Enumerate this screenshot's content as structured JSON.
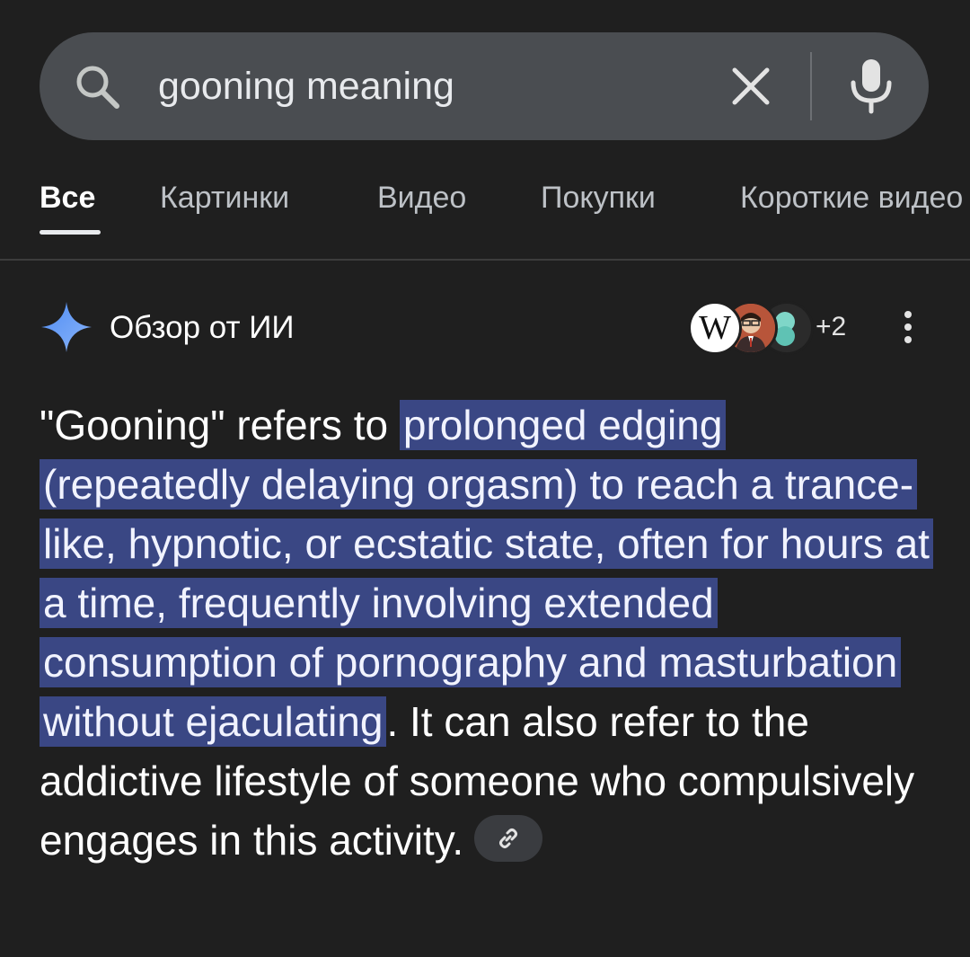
{
  "search": {
    "query": "gooning meaning",
    "icons": {
      "search": "search-icon",
      "clear": "close-icon",
      "voice": "microphone-icon"
    }
  },
  "tabs": [
    {
      "label": "Все",
      "active": true
    },
    {
      "label": "Картинки",
      "active": false
    },
    {
      "label": "Видео",
      "active": false
    },
    {
      "label": "Покупки",
      "active": false
    },
    {
      "label": "Короткие видео",
      "active": false
    }
  ],
  "ai_overview": {
    "title": "Обзор от ИИ",
    "source_more": "+2",
    "sources": [
      {
        "icon": "wikipedia-icon",
        "glyph": "W"
      },
      {
        "icon": "person-avatar-icon"
      },
      {
        "icon": "site-logo-icon"
      }
    ],
    "text_before": "\"Gooning\" refers to ",
    "text_highlight": "prolonged edging (repeatedly delaying orgasm) to reach a trance-like, hypnotic, or ecstatic state, often for hours at a time, frequently involving extended consumption of pornography and masturbation without ejaculating",
    "text_after": ". It can also refer to the addictive lifestyle of someone who compulsively engages in this activity.",
    "highlight_color": "#3a4784"
  },
  "colors": {
    "background": "#1f1f1f",
    "search_bar": "#4a4d51",
    "spark_gradient": [
      "#4f8df5",
      "#8ab4f8"
    ]
  }
}
